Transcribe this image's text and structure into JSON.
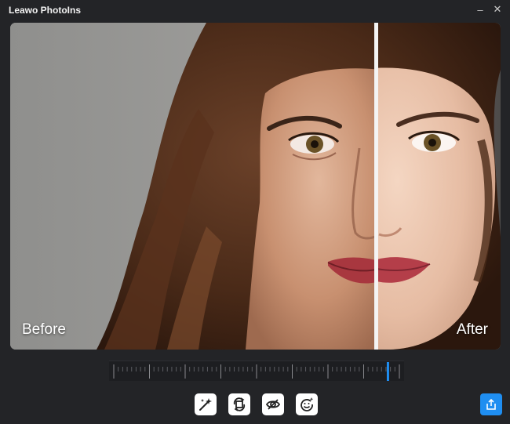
{
  "window": {
    "title": "Leawo PhotoIns",
    "minimize_icon": "–",
    "close_icon": "✕"
  },
  "viewer": {
    "before_label": "Before",
    "after_label": "After",
    "split_position": 0.746
  },
  "slider": {
    "value": 0.96,
    "accent": "#1f8ef1"
  },
  "toolbar": {
    "tools": [
      "magic-wand-icon",
      "rotate-crop-icon",
      "eye-icon",
      "face-retouch-icon"
    ],
    "share_icon": "share-icon"
  },
  "colors": {
    "background": "#232427",
    "share_button": "#1f8ef1"
  }
}
